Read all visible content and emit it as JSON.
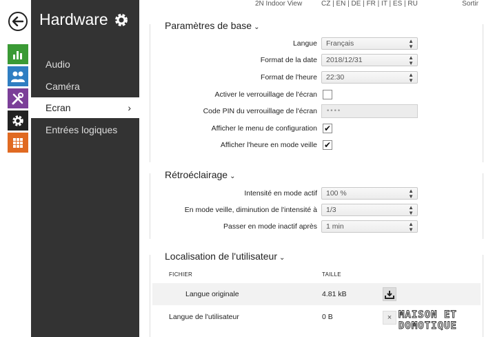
{
  "topbar": {
    "product": "2N Indoor View",
    "languages": "CZ | EN | DE | FR | IT | ES | RU",
    "logout": "Sortir"
  },
  "rail": {
    "icons": [
      "back-arrow-icon",
      "bar-chart-icon",
      "users-icon",
      "tools-icon",
      "gear-icon",
      "grid-icon"
    ],
    "colors": {
      "chart": "#3a9a35",
      "users": "#2f7ec2",
      "tools": "#7b3f98",
      "gear": "#222222",
      "grid": "#e06a22"
    }
  },
  "menu": {
    "title": "Hardware",
    "items": [
      {
        "label": "Audio",
        "active": false
      },
      {
        "label": "Caméra",
        "active": false
      },
      {
        "label": "Ecran",
        "active": true
      },
      {
        "label": "Entrées logiques",
        "active": false
      }
    ],
    "chevron": "›"
  },
  "basic": {
    "title": "Paramètres de base",
    "language": {
      "label": "Langue",
      "value": "Français"
    },
    "date_format": {
      "label": "Format de la date",
      "value": "2018/12/31"
    },
    "time_format": {
      "label": "Format de l'heure",
      "value": "22:30"
    },
    "screen_lock": {
      "label": "Activer le verrouillage de l'écran",
      "checked": false
    },
    "pin": {
      "label": "Code PIN du verrouillage de l'écran",
      "value": "••••"
    },
    "config_menu": {
      "label": "Afficher le menu de configuration",
      "checked": true,
      "mark": "✔"
    },
    "standby_time": {
      "label": "Afficher l'heure en mode veille",
      "checked": true,
      "mark": "✔"
    }
  },
  "backlight": {
    "title": "Rétroéclairage",
    "active_intensity": {
      "label": "Intensité en mode actif",
      "value": "100 %"
    },
    "standby_reduction": {
      "label": "En mode veille, diminution de l'intensité à",
      "value": "1/3"
    },
    "inactive_after": {
      "label": "Passer en mode inactif après",
      "value": "1 min"
    }
  },
  "localization": {
    "title": "Localisation de l'utilisateur",
    "columns": {
      "file": "FICHIER",
      "size": "TAILLE"
    },
    "rows": [
      {
        "name": "Langue originale",
        "size": "4.81 kB"
      },
      {
        "name": "Langue de l'utilisateur",
        "size": "0 B",
        "delete": "×"
      }
    ]
  },
  "watermark": {
    "line1": "MAISON ET",
    "line2": "DOMOTIQUE"
  }
}
